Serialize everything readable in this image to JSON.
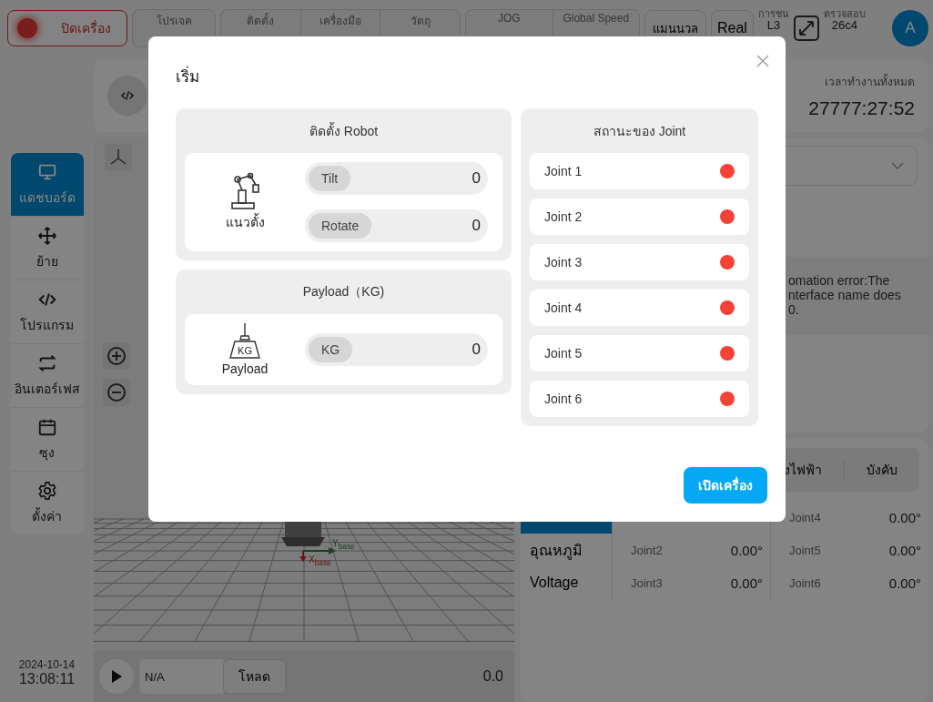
{
  "header": {
    "power": "ปิดเครื่อง",
    "groups": [
      {
        "items": [
          {
            "label": "โปรเจค"
          }
        ]
      },
      {
        "items": [
          {
            "label": "ติดตั้ง"
          },
          {
            "label": "เครื่องมือ"
          },
          {
            "label": "วัตถุ"
          }
        ]
      },
      {
        "items": [
          {
            "label": "JOG"
          },
          {
            "label": "Global Speed"
          }
        ]
      }
    ],
    "mode": "แมนนวล",
    "real": "Real",
    "collision": {
      "label": "การชน",
      "value": "L3"
    },
    "check": {
      "label": "ตรวจสอบ",
      "value": "26c4"
    },
    "avatar": "A"
  },
  "sidebar": {
    "items": [
      {
        "label": "แดชบอร์ด",
        "selected": true
      },
      {
        "label": "ย้าย",
        "selected": false
      },
      {
        "label": "โปรแกรม",
        "selected": false
      },
      {
        "label": "อินเตอร์เฟส",
        "selected": false
      },
      {
        "label": "ซุง",
        "selected": false
      },
      {
        "label": "ตั้งค่า",
        "selected": false
      }
    ]
  },
  "clock": {
    "date": "2024-10-14",
    "time": "13:08:11"
  },
  "runtime": {
    "label": "เวลาทำงานทั้งหมด",
    "value": "27777:27:52"
  },
  "viewport": {
    "axes": [
      "X$_{base}$",
      "Y$_{base}$"
    ],
    "program": "N/A",
    "load": "โหลด",
    "speed": "0.0"
  },
  "message": [
    "omation error:The",
    "nterface name does",
    "0."
  ],
  "joints_panel": {
    "modes": [
      "งไฟฟ้า",
      "บังคับ"
    ],
    "tabs": [
      {
        "selected": true
      },
      {
        "label": "อุณหภูมิ",
        "selected": false
      },
      {
        "label": "Voltage",
        "selected": false
      }
    ],
    "readings": [
      {
        "name": "Joint2",
        "value": "0.00°"
      },
      {
        "name": "Joint3",
        "value": "0.00°"
      },
      {
        "name": "Joint4",
        "value": "0.00°"
      },
      {
        "name": "Joint5",
        "value": "0.00°"
      },
      {
        "name": "Joint6",
        "value": "0.00°"
      }
    ]
  },
  "dialog": {
    "title": "เริ่ม",
    "install": {
      "title": "ติดตั้ง Robot",
      "mount": "แนวตั้ง",
      "fields": [
        {
          "label": "Tilt",
          "value": "0"
        },
        {
          "label": "Rotate",
          "value": "0"
        }
      ]
    },
    "payload": {
      "title": "Payload（KG)",
      "weight": "KG",
      "caption": "Payload",
      "fields": [
        {
          "label": "KG",
          "value": "0"
        }
      ]
    },
    "joint_status": {
      "title": "สถานะของ Joint",
      "joints": [
        {
          "name": "Joint 1",
          "color": "#f44336"
        },
        {
          "name": "Joint 2",
          "color": "#f44336"
        },
        {
          "name": "Joint 3",
          "color": "#f44336"
        },
        {
          "name": "Joint 4",
          "color": "#f44336"
        },
        {
          "name": "Joint 5",
          "color": "#f44336"
        },
        {
          "name": "Joint 6",
          "color": "#f44336"
        }
      ]
    },
    "start": "เปิดเครื่อง"
  }
}
